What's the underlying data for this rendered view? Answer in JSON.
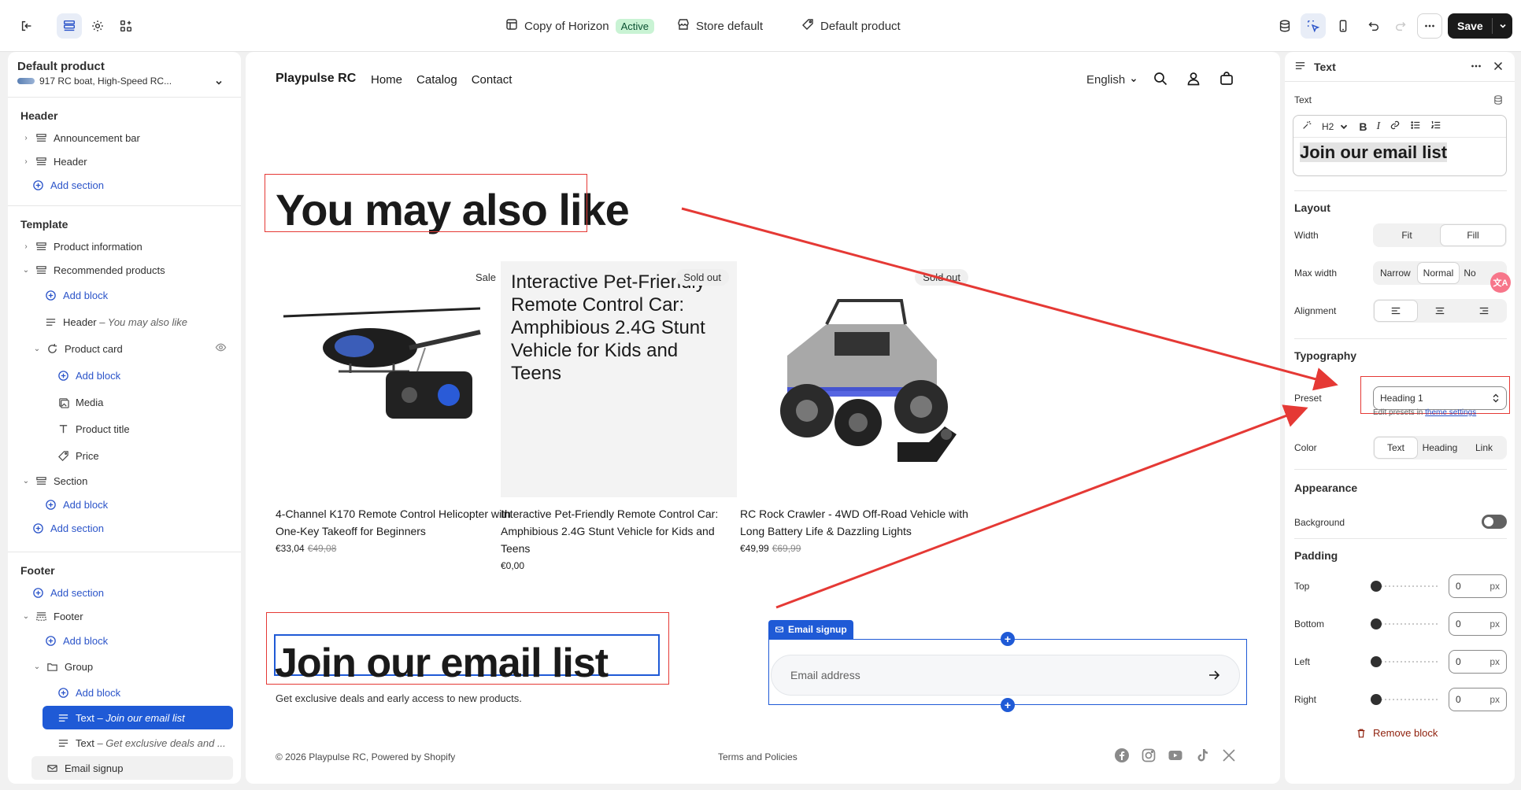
{
  "topbar": {
    "theme_name": "Copy of Horizon",
    "theme_status": "Active",
    "store": "Store default",
    "product": "Default product",
    "save_label": "Save"
  },
  "left": {
    "title": "Default product",
    "subtitle": "917 RC boat, High-Speed RC...",
    "header_section": {
      "title": "Header",
      "items": [
        "Announcement bar",
        "Header"
      ],
      "add_section": "Add section"
    },
    "template_section": {
      "title": "Template",
      "product_information": "Product information",
      "recommended_products": "Recommended products",
      "add_block_1": "Add block",
      "header_item": "Header",
      "header_item_sub": "– You may also like",
      "product_card": "Product card",
      "add_block_2": "Add block",
      "media": "Media",
      "product_title": "Product title",
      "price": "Price",
      "section": "Section",
      "add_block_3": "Add block",
      "add_section": "Add section"
    },
    "footer_section": {
      "title": "Footer",
      "add_section": "Add section",
      "footer": "Footer",
      "add_block_1": "Add block",
      "group": "Group",
      "add_block_2": "Add block",
      "text_selected": "Text",
      "text_selected_sub": "– Join our email list",
      "text_2": "Text",
      "text_2_sub": "– Get exclusive deals and ...",
      "email_signup": "Email signup"
    }
  },
  "preview": {
    "logo": "Playpulse RC",
    "nav": [
      "Home",
      "Catalog",
      "Contact"
    ],
    "language": "English",
    "heading": "You may also like",
    "products": [
      {
        "badge": "Sale",
        "title": "4-Channel K170 Remote Control Helicopter with One-Key Takeoff for Beginners",
        "price": "€33,04",
        "compare": "€49,08"
      },
      {
        "badge": "Sold out",
        "placeholder": "Interactive Pet-Friendly Remote Control Car: Amphibious 2.4G Stunt Vehicle for Kids and Teens",
        "title": "Interactive Pet-Friendly Remote Control Car: Amphibious 2.4G Stunt Vehicle for Kids and Teens",
        "price": "€0,00"
      },
      {
        "badge": "Sold out",
        "title": "RC Rock Crawler - 4WD Off-Road Vehicle with Long Battery Life & Dazzling Lights",
        "price": "€49,99",
        "compare": "€69,99"
      }
    ],
    "join_heading": "Join our email list",
    "join_sub": "Get exclusive deals and early access to new products.",
    "email_tab": "Email signup",
    "email_placeholder": "Email address",
    "copyright": "© 2026 Playpulse RC, Powered by Shopify",
    "terms": "Terms and Policies"
  },
  "right": {
    "title": "Text",
    "text_label": "Text",
    "heading_level": "H2",
    "editor_text": "Join our email list",
    "layout": "Layout",
    "width_label": "Width",
    "width_opts": [
      "Fit",
      "Fill"
    ],
    "maxwidth_label": "Max width",
    "maxwidth_opts": [
      "Narrow",
      "Normal",
      "No"
    ],
    "alignment_label": "Alignment",
    "typography": "Typography",
    "preset_label": "Preset",
    "preset_value": "Heading 1",
    "hint_prefix": "Edit presets in ",
    "hint_link": "theme settings",
    "color_label": "Color",
    "color_opts": [
      "Text",
      "Heading",
      "Link"
    ],
    "appearance": "Appearance",
    "background_label": "Background",
    "padding": "Padding",
    "pad_top": "Top",
    "pad_bottom": "Bottom",
    "pad_left": "Left",
    "pad_right": "Right",
    "pad_values": [
      "0",
      "0",
      "0",
      "0"
    ],
    "unit": "px",
    "remove": "Remove block"
  },
  "colors": {
    "accent": "#1f5ad6",
    "annotation_red": "#e53935",
    "save_bg": "#1a1a1a"
  }
}
